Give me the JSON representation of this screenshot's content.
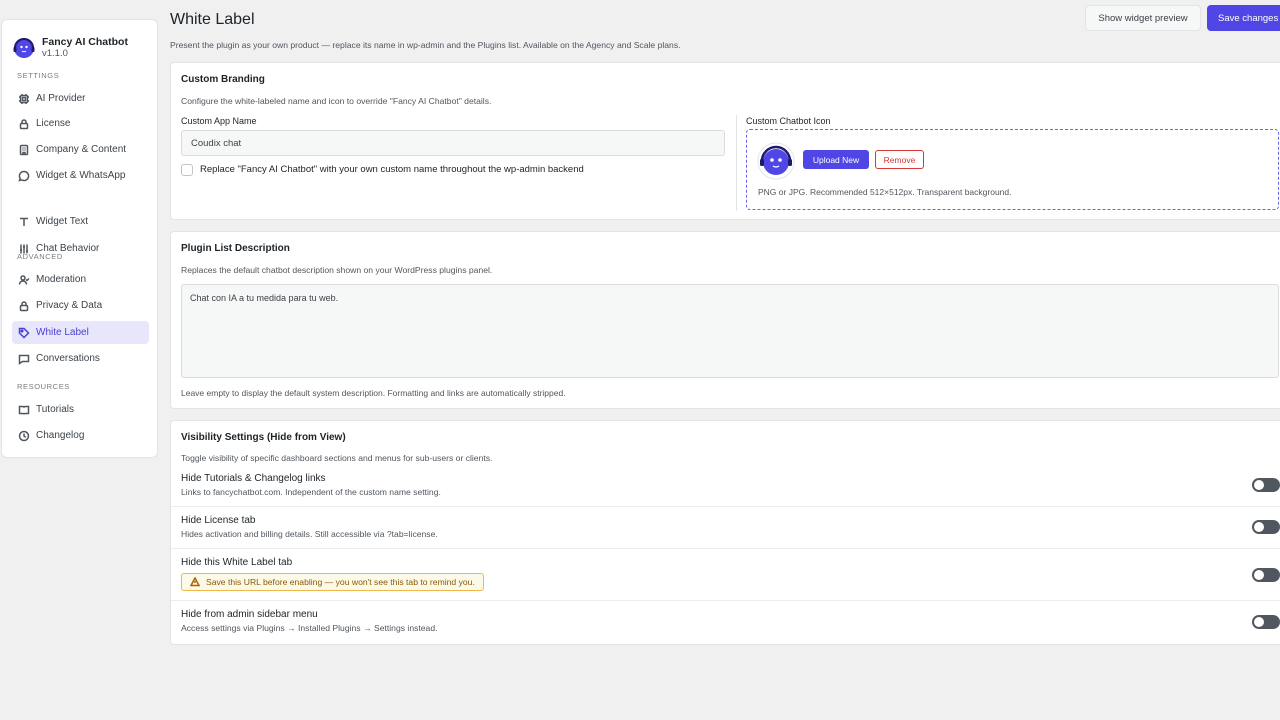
{
  "brand": {
    "name": "Fancy AI Chatbot",
    "version": "v1.1.0"
  },
  "sidebar": {
    "sections": {
      "settings": "SETTINGS",
      "advanced": "ADVANCED",
      "resources": "RESOURCES"
    },
    "items": [
      {
        "label": "AI Provider",
        "icon": "chip-icon"
      },
      {
        "label": "License",
        "icon": "lock-icon"
      },
      {
        "label": "Company & Content",
        "icon": "building-icon"
      },
      {
        "label": "Widget & WhatsApp",
        "icon": "chat-bubble-icon"
      },
      {
        "label": "Widget Text",
        "icon": "text-icon"
      },
      {
        "label": "Chat Behavior",
        "icon": "sliders-icon"
      },
      {
        "label": "Moderation",
        "icon": "user-check-icon"
      },
      {
        "label": "Privacy & Data",
        "icon": "lock-icon"
      },
      {
        "label": "White Label",
        "icon": "tag-icon"
      },
      {
        "label": "Conversations",
        "icon": "message-icon"
      },
      {
        "label": "Tutorials",
        "icon": "book-icon"
      },
      {
        "label": "Changelog",
        "icon": "clock-icon"
      }
    ],
    "active": "White Label"
  },
  "header": {
    "title": "White Label",
    "description": "Present the plugin as your own product — replace its name in wp-admin and the Plugins list. Available on the Agency and Scale plans.",
    "preview_label": "Show widget preview",
    "save_label": "Save changes"
  },
  "branding": {
    "title": "Custom Branding",
    "subtitle": "Configure the white-labeled name and icon to override \"Fancy AI Chatbot\" details.",
    "app_name_label": "Custom App Name",
    "app_name_value": "Coudix chat",
    "replace_label": "Replace \"Fancy AI Chatbot\" with your own custom name throughout the wp-admin backend",
    "replace_checked": false,
    "icon_label": "Custom Chatbot Icon",
    "upload_label": "Upload New",
    "remove_label": "Remove",
    "icon_hint": "PNG or JPG. Recommended 512×512px. Transparent background."
  },
  "plugin_list": {
    "title": "Plugin List Description",
    "subtitle": "Replaces the default chatbot description shown on your WordPress plugins panel.",
    "value": "Chat con IA a tu medida para tu web.",
    "hint": "Leave empty to display the default system description. Formatting and links are automatically stripped."
  },
  "visibility": {
    "title": "Visibility Settings (Hide from View)",
    "subtitle": "Toggle visibility of specific dashboard sections and menus for sub-users or clients.",
    "rows": [
      {
        "title": "Hide Tutorials & Changelog links",
        "sub": "Links to fancychatbot.com. Independent of the custom name setting.",
        "on": false
      },
      {
        "title": "Hide License tab",
        "sub": "Hides activation and billing details. Still accessible via ?tab=license.",
        "on": false
      },
      {
        "title": "Hide this White Label tab",
        "warning": "Save this URL before enabling — you won't see this tab to remind you.",
        "on": false
      },
      {
        "title": "Hide from admin sidebar menu",
        "sub": "Access settings via Plugins → Installed Plugins → Settings instead.",
        "on": false
      }
    ]
  },
  "colors": {
    "accent": "#4f46e5",
    "danger": "#d63638",
    "warning_border": "#f0b849"
  }
}
